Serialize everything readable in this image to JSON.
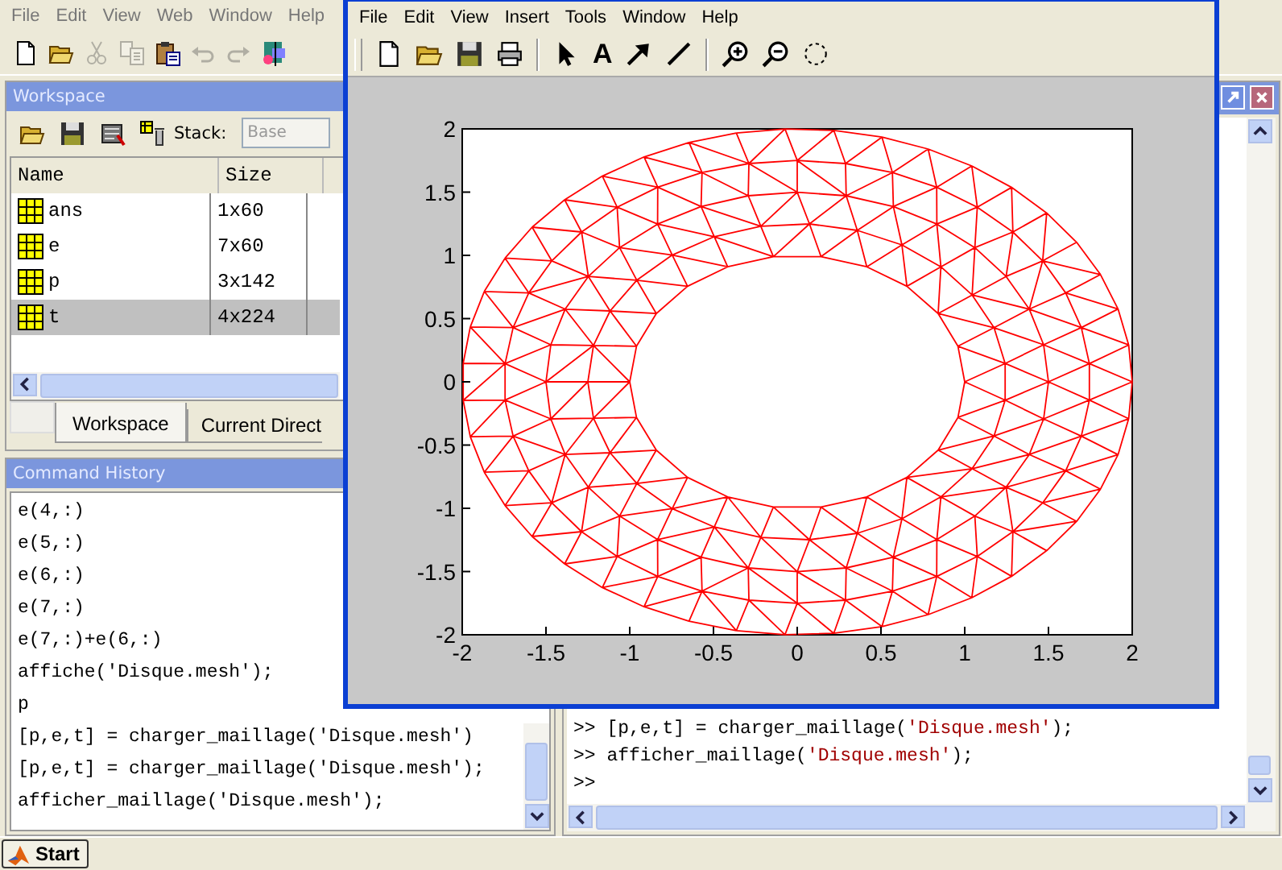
{
  "menu": [
    "File",
    "Edit",
    "View",
    "Web",
    "Window",
    "Help"
  ],
  "toolbar": [
    {
      "kind": "new",
      "disabled": false
    },
    {
      "kind": "open",
      "disabled": false
    },
    {
      "kind": "cut",
      "disabled": true
    },
    {
      "kind": "copy",
      "disabled": true
    },
    {
      "kind": "paste",
      "disabled": false
    },
    {
      "kind": "undo",
      "disabled": true
    },
    {
      "kind": "redo",
      "disabled": true
    },
    {
      "kind": "blocks",
      "disabled": false
    }
  ],
  "workspace": {
    "title": "Workspace",
    "toolbar": [
      {
        "kind": "open"
      },
      {
        "kind": "save"
      },
      {
        "kind": "import"
      },
      {
        "kind": "delete"
      }
    ],
    "stack": {
      "label": "Stack:",
      "value": "Base",
      "disabled": true
    },
    "columns": [
      "Name",
      "Size"
    ],
    "rows": [
      {
        "name": "ans",
        "size": "1x60",
        "selected": false
      },
      {
        "name": "e",
        "size": "7x60",
        "selected": false
      },
      {
        "name": "p",
        "size": "3x142",
        "selected": false
      },
      {
        "name": "t",
        "size": "4x224",
        "selected": true
      }
    ],
    "tabs": [
      {
        "label": "Workspace",
        "selected": true
      },
      {
        "label": "Current Direct",
        "selected": false
      }
    ]
  },
  "history": {
    "title": "Command History",
    "lines": [
      "e(4,:)",
      "e(5,:)",
      "e(6,:)",
      "e(7,:)",
      "e(7,:)+e(6,:)",
      "affiche('Disque.mesh');",
      "p",
      "[p,e,t] = charger_maillage('Disque.mesh')",
      "[p,e,t] = charger_maillage('Disque.mesh');",
      "afficher_maillage('Disque.mesh');"
    ]
  },
  "command_window": {
    "lines": [
      {
        "prompt": ">>",
        "parts": [
          {
            "kind": "code",
            "text": " [p,e,t] = charger_maillage("
          },
          {
            "kind": "string",
            "text": "'Disque.mesh'"
          },
          {
            "kind": "code",
            "text": ");"
          }
        ]
      },
      {
        "prompt": ">>",
        "parts": [
          {
            "kind": "code",
            "text": " afficher_maillage("
          },
          {
            "kind": "string",
            "text": "'Disque.mesh'"
          },
          {
            "kind": "code",
            "text": ");"
          }
        ]
      },
      {
        "prompt": ">>"
      }
    ]
  },
  "figure": {
    "menu": [
      "File",
      "Edit",
      "View",
      "Insert",
      "Tools",
      "Window",
      "Help"
    ],
    "toolbar": [
      {
        "kind": "new"
      },
      {
        "kind": "open"
      },
      {
        "kind": "save"
      },
      {
        "kind": "print"
      },
      {
        "kind": "sep"
      },
      {
        "kind": "pointer"
      },
      {
        "kind": "text",
        "label": "A"
      },
      {
        "kind": "arrow"
      },
      {
        "kind": "line"
      },
      {
        "kind": "sep"
      },
      {
        "kind": "zoomin"
      },
      {
        "kind": "zoomout"
      },
      {
        "kind": "rotate"
      }
    ],
    "axes": {
      "xticks": [
        "-2",
        "-1.5",
        "-1",
        "-0.5",
        "0",
        "0.5",
        "1",
        "1.5",
        "2"
      ],
      "yticks": [
        "2",
        "1.5",
        "1",
        "0.5",
        "0",
        "-0.5",
        "-1",
        "-1.5",
        "-2"
      ]
    }
  },
  "taskbar": {
    "start": "Start"
  }
}
